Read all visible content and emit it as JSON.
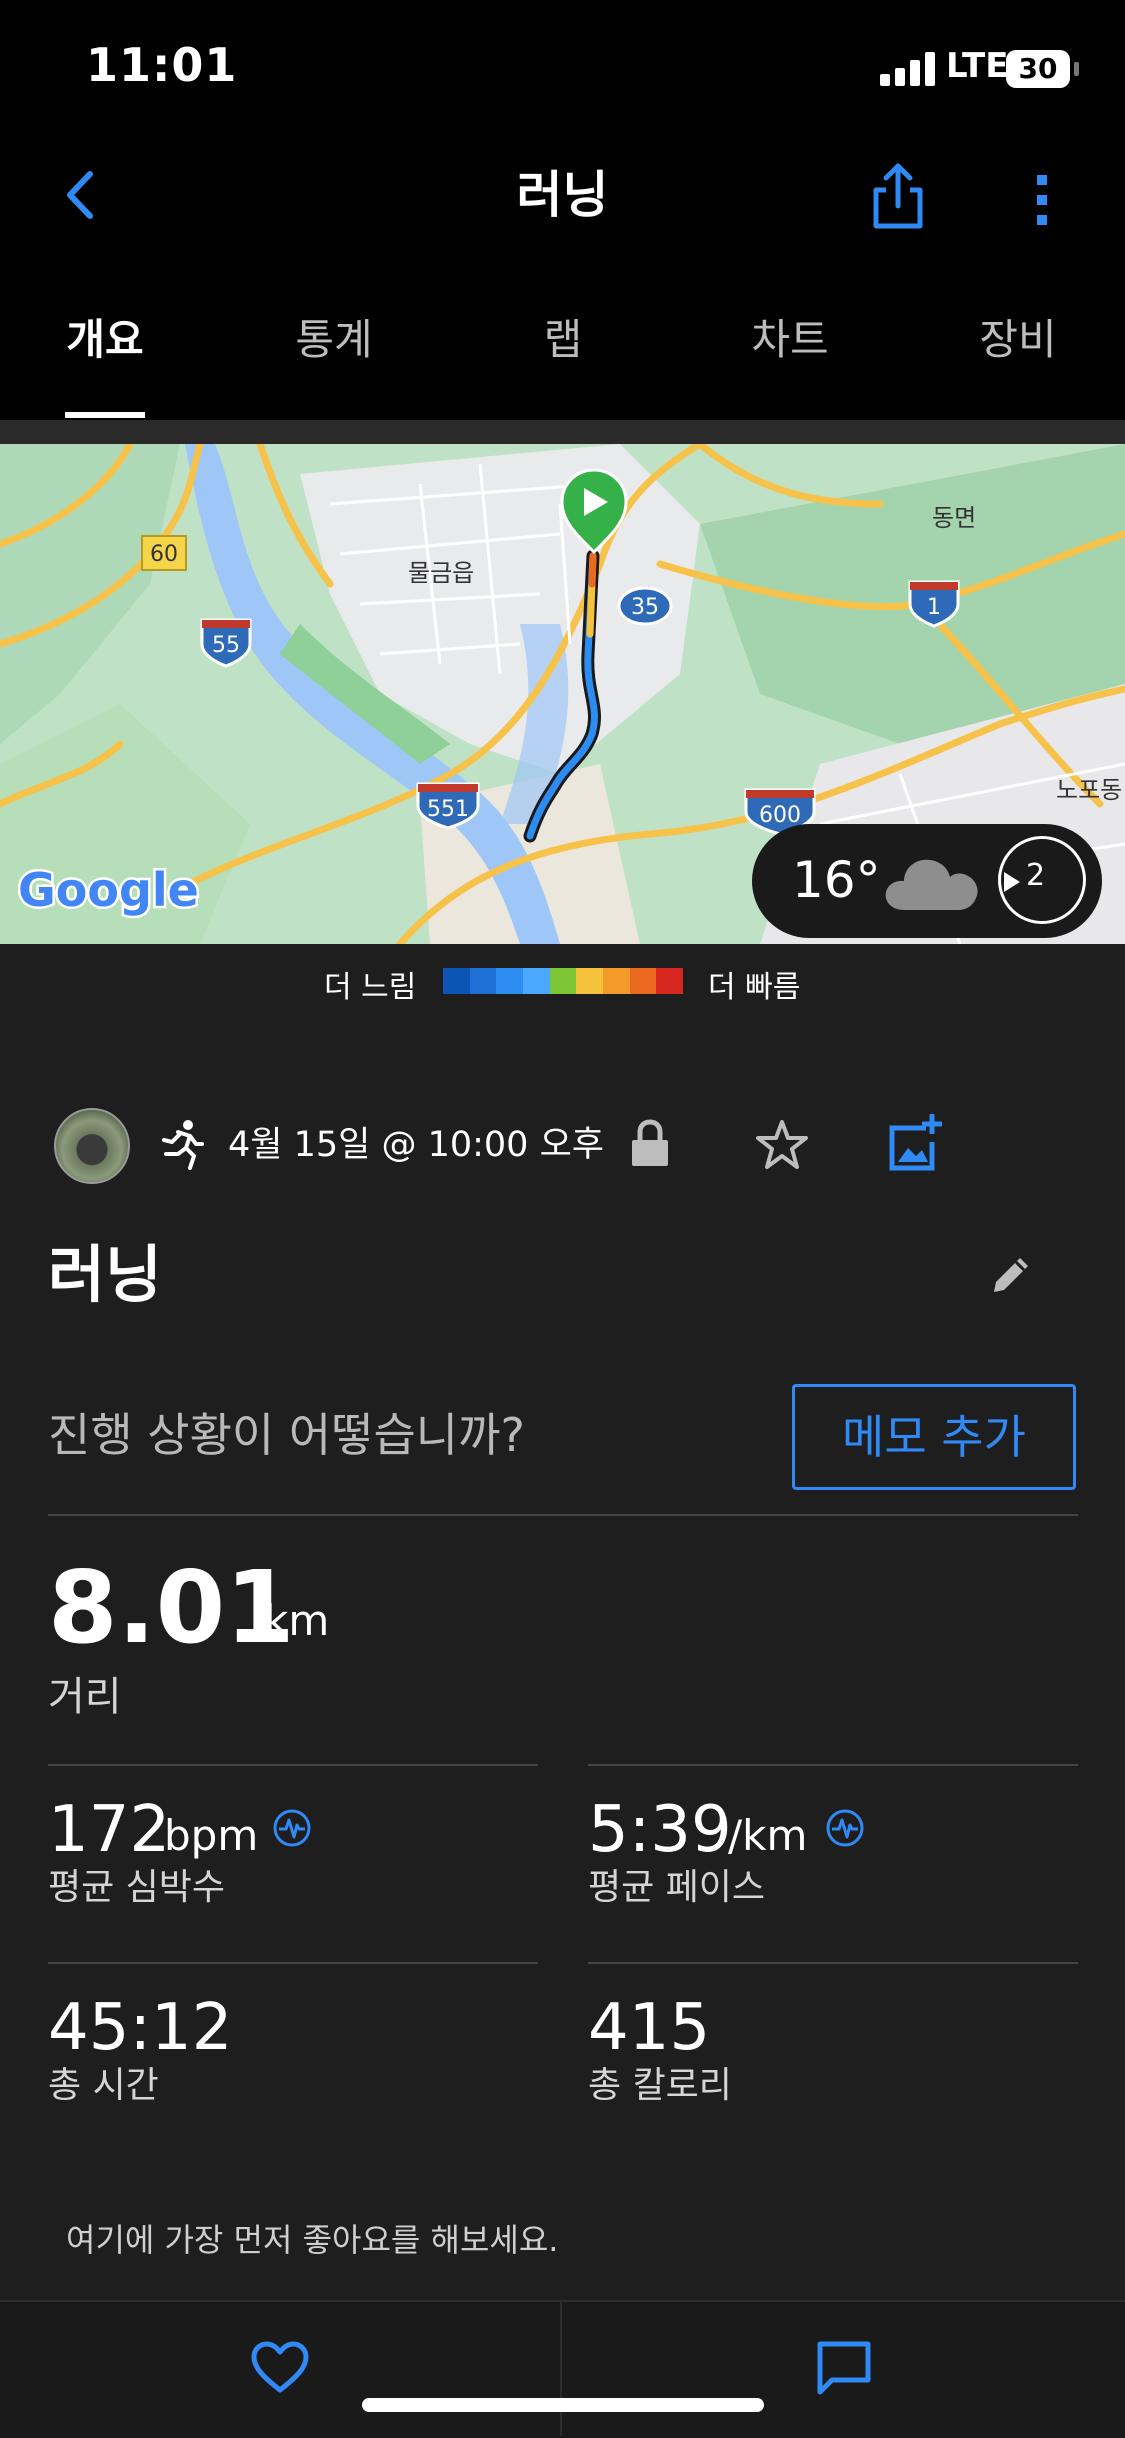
{
  "status_bar": {
    "time": "11:01",
    "network": "LTE",
    "battery": "30"
  },
  "nav": {
    "title": "러닝"
  },
  "tabs": [
    {
      "label": "개요",
      "active": true
    },
    {
      "label": "통계",
      "active": false
    },
    {
      "label": "랩",
      "active": false
    },
    {
      "label": "차트",
      "active": false
    },
    {
      "label": "장비",
      "active": false
    }
  ],
  "map": {
    "places": {
      "town1": "물금읍",
      "town2": "동면",
      "town3": "노포동"
    },
    "roads": [
      "60",
      "55",
      "35",
      "1",
      "551",
      "600"
    ],
    "logo": "Google",
    "weather": {
      "temperature": "16°",
      "icon": "cloud-icon",
      "wind": "2"
    }
  },
  "legend": {
    "slower": "더 느림",
    "faster": "더 빠름",
    "colors": [
      "#0b56b5",
      "#1e6fd6",
      "#2c8cf0",
      "#4aa8ff",
      "#7cc636",
      "#f5c33b",
      "#f39a2b",
      "#ec6a20",
      "#d7261e"
    ]
  },
  "activity": {
    "datetime": "4월 15일 @ 10:00 오후",
    "title": "러닝",
    "notes_prompt": "진행 상황이 어떻습니까?",
    "memo_button": "메모 추가"
  },
  "stats": {
    "distance": {
      "value": "8.01",
      "unit": "km",
      "label": "거리"
    },
    "heart_rate": {
      "value": "172",
      "unit": "bpm",
      "label": "평균 심박수"
    },
    "pace": {
      "value": "5:39",
      "unit": "/km",
      "label": "평균 페이스"
    },
    "time": {
      "value": "45:12",
      "label": "총 시간"
    },
    "calories": {
      "value": "415",
      "label": "총 칼로리"
    }
  },
  "like_prompt": "여기에 가장 먼저 좋아요를 해보세요.",
  "colors": {
    "accent": "#2f8af5",
    "background": "#1e1e1e"
  }
}
